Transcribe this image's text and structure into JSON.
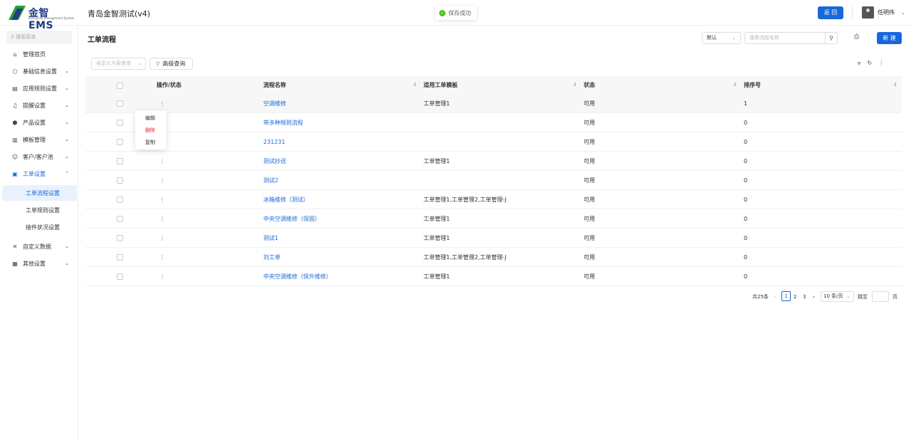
{
  "header": {
    "logo_text": "金智 EMS",
    "logo_subtitle": "Enterprise Management System",
    "app_title": "青岛金智测试(v4)",
    "toast": "保存成功",
    "back_label": "返 回",
    "user_name": "任明伟"
  },
  "sidebar": {
    "search_placeholder": "搜索菜单",
    "items": [
      {
        "label": "管理首页",
        "icon": "home-icon",
        "glyph": "⌂"
      },
      {
        "label": "基础信息设置",
        "icon": "cube-icon",
        "glyph": "⬡"
      },
      {
        "label": "应用规则设置",
        "icon": "document-icon",
        "glyph": "▤"
      },
      {
        "label": "提醒设置",
        "icon": "bell-icon",
        "glyph": "♫"
      },
      {
        "label": "产品设置",
        "icon": "box-icon",
        "glyph": "⬢"
      },
      {
        "label": "模板管理",
        "icon": "template-icon",
        "glyph": "▥"
      },
      {
        "label": "客户/客户池",
        "icon": "users-icon",
        "glyph": "☺"
      },
      {
        "label": "工单设置",
        "icon": "workorder-icon",
        "glyph": "▣"
      },
      {
        "label": "自定义数据",
        "icon": "tools-icon",
        "glyph": "✕"
      },
      {
        "label": "其他设置",
        "icon": "grid-icon",
        "glyph": "▦"
      }
    ],
    "sub_items": [
      {
        "label": "工单流程设置"
      },
      {
        "label": "工单规则设置"
      },
      {
        "label": "接件状况设置"
      }
    ]
  },
  "main": {
    "title": "工单流程",
    "select_default": "默认",
    "search_placeholder": "搜索流程名称",
    "new_label": "新 建",
    "custom_query_placeholder": "自定义方案查询",
    "advanced_query_label": "高级查询"
  },
  "table": {
    "columns": [
      "操作/状态",
      "流程名称",
      "适用工单模板",
      "状态",
      "排序号"
    ],
    "rows": [
      {
        "name": "空调维修",
        "template": "工单管理1",
        "status": "可用",
        "order": "1"
      },
      {
        "name": "带多种规则流程",
        "template": "",
        "status": "可用",
        "order": "0"
      },
      {
        "name": "231231",
        "template": "",
        "status": "可用",
        "order": "0"
      },
      {
        "name": "测试抄送",
        "template": "工单管理1",
        "status": "可用",
        "order": "0"
      },
      {
        "name": "测试2",
        "template": "",
        "status": "可用",
        "order": "0"
      },
      {
        "name": "冰箱维修（测试）",
        "template": "工单管理1,工单管理2,工单管理-J",
        "status": "可用",
        "order": "0"
      },
      {
        "name": "中央空调维修（保固）",
        "template": "工单管理1",
        "status": "可用",
        "order": "0"
      },
      {
        "name": "测试1",
        "template": "工单管理1",
        "status": "可用",
        "order": "0"
      },
      {
        "name": "刘工单",
        "template": "工单管理1,工单管理2,工单管理-J",
        "status": "可用",
        "order": "0"
      },
      {
        "name": "中央空调维修（保外维修）",
        "template": "工单管理1",
        "status": "可用",
        "order": "0"
      }
    ]
  },
  "context_menu": {
    "edit": "编辑",
    "delete": "删除",
    "copy": "复制"
  },
  "pagination": {
    "total": "共25条",
    "pages": [
      "1",
      "2",
      "3"
    ],
    "page_size": "10 条/页",
    "jump_label": "跳至",
    "page_suffix": "页"
  },
  "colors": {
    "accent": "#1668dc",
    "danger": "#f5222d",
    "success": "#52c41a"
  }
}
